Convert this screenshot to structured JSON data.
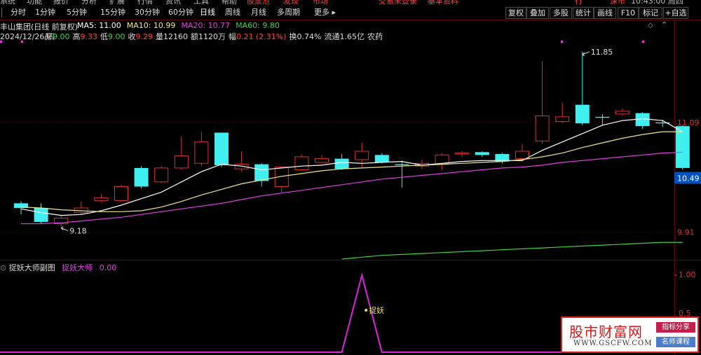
{
  "top_menu": [
    "系统",
    "功能",
    "报价",
    "分析",
    "扩展",
    "行情",
    "资讯",
    "工具",
    "帮助",
    "股票池",
    "发现",
    "市场",
    "交易未登录",
    "基本资料",
    "行",
    "深市",
    "10:43:00 周四"
  ],
  "toolbar": {
    "periods": [
      "分时",
      "1分钟",
      "5分钟",
      "15分钟",
      "30分钟",
      "60分钟",
      "日线",
      "周线",
      "月线",
      "多周期",
      "更多"
    ],
    "selected_period": "日线",
    "right_buttons": [
      "复权",
      "叠加",
      "多股",
      "统计",
      "画线",
      "F10",
      "标记",
      "+自选"
    ]
  },
  "stock": {
    "name": "丰山集团(日线 前复权)",
    "date": "2024/12/26/四",
    "open_label": "开",
    "open": "9.00",
    "high_label": "高",
    "high": "9.33",
    "low_label": "低",
    "low": "9.00",
    "close_label": "收",
    "close": "9.29",
    "volume_label": "量",
    "volume": "12160",
    "amount_label": "额",
    "amount": "1120万",
    "change_label": "幅",
    "change": "0.21 (2.31%)",
    "turnover": "换0.74%",
    "float_cap": "流通1.65亿",
    "industry": "农药"
  },
  "ma": [
    {
      "label": "MA5:",
      "value": "11.00",
      "color": "#ffffff"
    },
    {
      "label": "MA10:",
      "value": "10.99",
      "color": "#f0e68c"
    },
    {
      "label": "MA20:",
      "value": "10.77",
      "color": "#e040e0"
    },
    {
      "label": "MA60:",
      "value": "9.80",
      "color": "#40d040"
    }
  ],
  "price_axis": {
    "top": "11.09",
    "current": "10.49",
    "bottom": "9.91"
  },
  "annotations": {
    "high": "11.85",
    "low": "9.18"
  },
  "sub_chart": {
    "title": "捉妖大师副图",
    "indicator": "捉妖大师",
    "value": "0.00",
    "axis_top": "1.00",
    "axis_mid": "0.5",
    "signal_label": "捉妖",
    "signal_value": 1.0,
    "baseline_value": 0.0
  },
  "watermark": {
    "logo": "股市财富网",
    "url": "WWW.GSCFW.COM",
    "tag1": "指标分享",
    "tag2": "名师课程"
  },
  "chart_data": {
    "type": "candlestick",
    "candles": [
      {
        "o": 10.22,
        "c": 10.17,
        "h": 10.24,
        "l": 10.1
      },
      {
        "o": 10.17,
        "c": 10.02,
        "h": 10.22,
        "l": 10.0
      },
      {
        "o": 10.0,
        "c": 10.06,
        "h": 10.1,
        "l": 9.97
      },
      {
        "o": 10.12,
        "c": 10.17,
        "h": 10.24,
        "l": 10.1
      },
      {
        "o": 10.25,
        "c": 10.28,
        "h": 10.32,
        "l": 10.23
      },
      {
        "o": 10.25,
        "c": 10.4,
        "h": 10.42,
        "l": 10.23
      },
      {
        "o": 10.6,
        "c": 10.4,
        "h": 10.62,
        "l": 10.38
      },
      {
        "o": 10.45,
        "c": 10.6,
        "h": 10.62,
        "l": 10.44
      },
      {
        "o": 10.6,
        "c": 10.73,
        "h": 10.94,
        "l": 10.58
      },
      {
        "o": 10.65,
        "c": 10.88,
        "h": 10.99,
        "l": 10.62
      },
      {
        "o": 10.98,
        "c": 10.63,
        "h": 10.98,
        "l": 10.61
      },
      {
        "o": 10.59,
        "c": 10.64,
        "h": 10.78,
        "l": 10.56
      },
      {
        "o": 10.64,
        "c": 10.46,
        "h": 10.65,
        "l": 10.4
      },
      {
        "o": 10.4,
        "c": 10.61,
        "h": 10.62,
        "l": 10.34
      },
      {
        "o": 10.58,
        "c": 10.72,
        "h": 10.74,
        "l": 10.57
      },
      {
        "o": 10.66,
        "c": 10.7,
        "h": 10.74,
        "l": 10.65
      },
      {
        "o": 10.7,
        "c": 10.59,
        "h": 10.75,
        "l": 10.58
      },
      {
        "o": 10.69,
        "c": 10.78,
        "h": 10.87,
        "l": 10.6
      },
      {
        "o": 10.74,
        "c": 10.66,
        "h": 10.76,
        "l": 10.65
      },
      {
        "o": 10.64,
        "c": 10.63,
        "h": 10.68,
        "l": 10.39
      },
      {
        "o": 10.62,
        "c": 10.65,
        "h": 10.69,
        "l": 10.59
      },
      {
        "o": 10.64,
        "c": 10.74,
        "h": 10.76,
        "l": 10.58
      },
      {
        "o": 10.75,
        "c": 10.76,
        "h": 10.78,
        "l": 10.72
      },
      {
        "o": 10.77,
        "c": 10.74,
        "h": 10.78,
        "l": 10.72
      },
      {
        "o": 10.75,
        "c": 10.67,
        "h": 10.76,
        "l": 10.65
      },
      {
        "o": 10.7,
        "c": 10.78,
        "h": 10.86,
        "l": 10.67
      },
      {
        "o": 10.89,
        "c": 11.16,
        "h": 11.75,
        "l": 10.86
      },
      {
        "o": 11.1,
        "c": 11.15,
        "h": 11.3,
        "l": 11.08
      },
      {
        "o": 11.28,
        "c": 11.08,
        "h": 11.85,
        "l": 11.06
      },
      {
        "o": 11.15,
        "c": 11.14,
        "h": 11.18,
        "l": 11.06
      },
      {
        "o": 11.18,
        "c": 11.21,
        "h": 11.24,
        "l": 11.16
      },
      {
        "o": 11.19,
        "c": 11.05,
        "h": 11.2,
        "l": 11.02
      },
      {
        "o": 11.09,
        "c": 11.08,
        "h": 11.12,
        "l": 11.04
      },
      {
        "o": 11.05,
        "c": 10.6,
        "h": 11.06,
        "l": 10.58
      }
    ],
    "ma5": [
      10.16,
      10.12,
      10.09,
      10.1,
      10.14,
      10.2,
      10.27,
      10.34,
      10.45,
      10.56,
      10.64,
      10.62,
      10.58,
      10.6,
      10.62,
      10.63,
      10.66,
      10.65,
      10.66,
      10.67,
      10.63,
      10.65,
      10.67,
      10.68,
      10.68,
      10.68,
      10.79,
      10.88,
      10.97,
      11.06,
      11.11,
      11.13,
      11.11,
      10.99
    ],
    "ma10": [
      10.18,
      10.17,
      10.15,
      10.14,
      10.13,
      10.13,
      10.14,
      10.18,
      10.24,
      10.31,
      10.37,
      10.43,
      10.47,
      10.51,
      10.54,
      10.57,
      10.59,
      10.6,
      10.61,
      10.62,
      10.63,
      10.64,
      10.65,
      10.66,
      10.67,
      10.69,
      10.72,
      10.76,
      10.82,
      10.87,
      10.92,
      10.96,
      10.99,
      10.99
    ],
    "ma20": [
      10.0,
      10.0,
      10.01,
      10.03,
      10.05,
      10.07,
      10.1,
      10.13,
      10.16,
      10.19,
      10.22,
      10.26,
      10.3,
      10.33,
      10.36,
      10.39,
      10.42,
      10.45,
      10.48,
      10.5,
      10.52,
      10.54,
      10.56,
      10.58,
      10.6,
      10.61,
      10.63,
      10.66,
      10.68,
      10.7,
      10.72,
      10.74,
      10.76,
      10.77
    ],
    "ma60_start_index": 16,
    "ma60": [
      9.62,
      9.64,
      9.66,
      9.67,
      9.68,
      9.69,
      9.7,
      9.71,
      9.72,
      9.73,
      9.74,
      9.75,
      9.76,
      9.77,
      9.78,
      9.79,
      9.8,
      9.8
    ],
    "ylim": [
      9.62,
      11.97
    ],
    "signal": [
      0,
      0,
      0,
      0,
      0,
      0,
      0,
      0,
      0,
      0,
      0,
      0,
      0,
      0,
      0,
      0,
      0,
      1,
      0,
      0,
      0,
      0,
      0,
      0,
      0,
      0,
      0,
      0,
      0,
      0,
      0,
      0,
      0,
      0
    ]
  }
}
